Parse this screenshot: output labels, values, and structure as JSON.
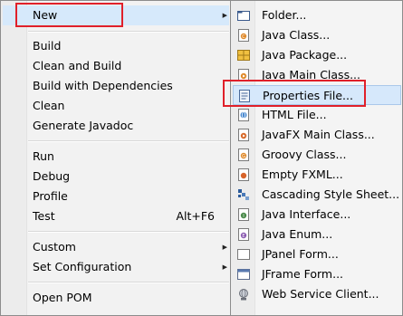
{
  "context_menu": {
    "items": [
      {
        "label": "New"
      },
      {
        "label": "Build"
      },
      {
        "label": "Clean and Build"
      },
      {
        "label": "Build with Dependencies"
      },
      {
        "label": "Clean"
      },
      {
        "label": "Generate Javadoc"
      },
      {
        "label": "Run"
      },
      {
        "label": "Debug"
      },
      {
        "label": "Profile"
      },
      {
        "label": "Test",
        "shortcut": "Alt+F6"
      },
      {
        "label": "Custom"
      },
      {
        "label": "Set Configuration"
      },
      {
        "label": "Open POM"
      }
    ]
  },
  "new_submenu": {
    "items": [
      {
        "label": "Folder...",
        "icon": "folder-icon"
      },
      {
        "label": "Java Class...",
        "icon": "java-class-icon"
      },
      {
        "label": "Java Package...",
        "icon": "java-package-icon"
      },
      {
        "label": "Java Main Class...",
        "icon": "java-main-class-icon"
      },
      {
        "label": "Properties File...",
        "icon": "properties-file-icon"
      },
      {
        "label": "HTML File...",
        "icon": "html-file-icon"
      },
      {
        "label": "JavaFX Main Class...",
        "icon": "javafx-main-class-icon"
      },
      {
        "label": "Groovy Class...",
        "icon": "groovy-class-icon"
      },
      {
        "label": "Empty FXML...",
        "icon": "fxml-file-icon"
      },
      {
        "label": "Cascading Style Sheet...",
        "icon": "css-file-icon"
      },
      {
        "label": "Java Interface...",
        "icon": "java-interface-icon"
      },
      {
        "label": "Java Enum...",
        "icon": "java-enum-icon"
      },
      {
        "label": "JPanel Form...",
        "icon": "jpanel-form-icon"
      },
      {
        "label": "JFrame Form...",
        "icon": "jframe-form-icon"
      },
      {
        "label": "Web Service Client...",
        "icon": "web-service-client-icon"
      }
    ]
  },
  "highlight_color": "#e0202a"
}
